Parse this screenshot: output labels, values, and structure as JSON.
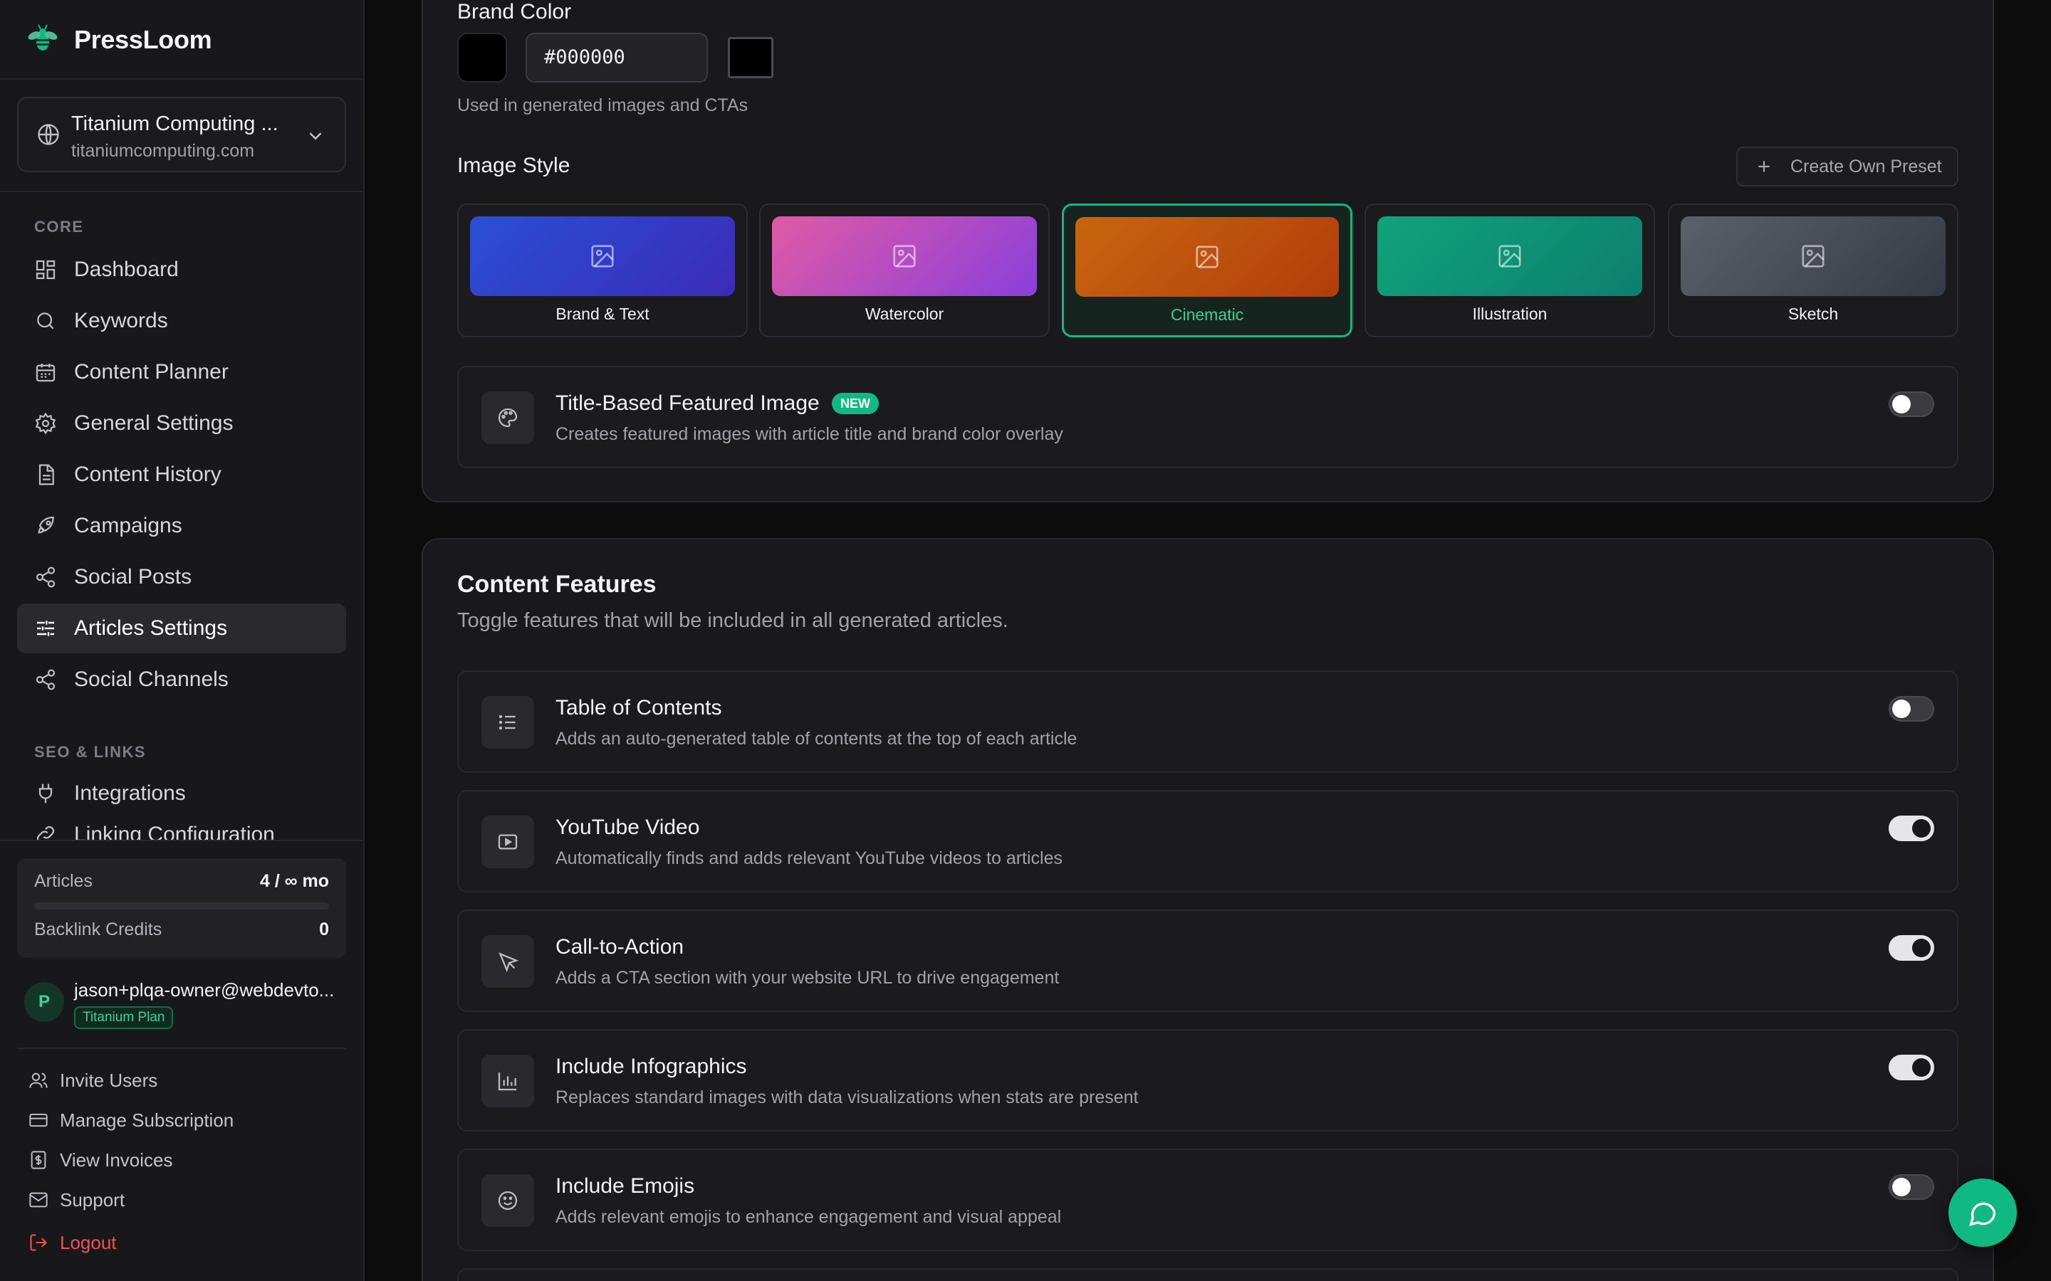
{
  "app": {
    "name": "PressLoom"
  },
  "site": {
    "name": "Titanium Computing ...",
    "domain": "titaniumcomputing.com"
  },
  "sidebar": {
    "core_label": "CORE",
    "seo_label": "SEO & LINKS",
    "items": [
      {
        "label": "Dashboard",
        "icon": "dashboard-icon"
      },
      {
        "label": "Keywords",
        "icon": "search-icon"
      },
      {
        "label": "Content Planner",
        "icon": "calendar-icon"
      },
      {
        "label": "General Settings",
        "icon": "gear-icon"
      },
      {
        "label": "Content History",
        "icon": "document-icon"
      },
      {
        "label": "Campaigns",
        "icon": "rocket-icon"
      },
      {
        "label": "Social Posts",
        "icon": "share-icon"
      },
      {
        "label": "Articles Settings",
        "icon": "sliders-icon",
        "active": true
      },
      {
        "label": "Social Channels",
        "icon": "share-icon"
      }
    ],
    "seo_items": [
      {
        "label": "Integrations",
        "icon": "plug-icon"
      },
      {
        "label": "Linking Configuration",
        "icon": "link-icon"
      }
    ]
  },
  "usage": {
    "articles_label": "Articles",
    "articles_value": "4 / ∞ mo",
    "backlink_label": "Backlink Credits",
    "backlink_value": "0"
  },
  "user": {
    "initial": "P",
    "email": "jason+plqa-owner@webdevto...",
    "plan": "Titanium Plan"
  },
  "footer_links": [
    {
      "label": "Invite Users",
      "icon": "users-icon"
    },
    {
      "label": "Manage Subscription",
      "icon": "credit-card-icon"
    },
    {
      "label": "View Invoices",
      "icon": "invoice-icon"
    },
    {
      "label": "Support",
      "icon": "mail-icon"
    },
    {
      "label": "Logout",
      "icon": "logout-icon"
    }
  ],
  "brand_color": {
    "label": "Brand Color",
    "value": "#000000",
    "hint": "Used in generated images and CTAs"
  },
  "image_style": {
    "label": "Image Style",
    "preset_button": "Create Own Preset",
    "options": [
      {
        "label": "Brand & Text",
        "from": "#2a4fd6",
        "to": "#3b2bb8"
      },
      {
        "label": "Watercolor",
        "from": "#e05aa6",
        "to": "#8a3fdc"
      },
      {
        "label": "Cinematic",
        "from": "#c8660e",
        "to": "#b23d0c",
        "selected": true
      },
      {
        "label": "Illustration",
        "from": "#10a37a",
        "to": "#0d7f6f"
      },
      {
        "label": "Sketch",
        "from": "#5b606b",
        "to": "#353a45"
      }
    ]
  },
  "title_featured": {
    "title": "Title-Based Featured Image",
    "badge": "NEW",
    "desc": "Creates featured images with article title and brand color overlay",
    "enabled": false
  },
  "content_features": {
    "title": "Content Features",
    "subtitle": "Toggle features that will be included in all generated articles.",
    "items": [
      {
        "title": "Table of Contents",
        "desc": "Adds an auto-generated table of contents at the top of each article",
        "icon": "list-icon",
        "enabled": false
      },
      {
        "title": "YouTube Video",
        "desc": "Automatically finds and adds relevant YouTube videos to articles",
        "icon": "video-icon",
        "enabled": true
      },
      {
        "title": "Call-to-Action",
        "desc": "Adds a CTA section with your website URL to drive engagement",
        "icon": "cursor-icon",
        "enabled": true
      },
      {
        "title": "Include Infographics",
        "desc": "Replaces standard images with data visualizations when stats are present",
        "icon": "bar-chart-icon",
        "enabled": true
      },
      {
        "title": "Include Emojis",
        "desc": "Adds relevant emojis to enhance engagement and visual appeal",
        "icon": "smile-icon",
        "enabled": false
      }
    ]
  },
  "colors": {
    "accent": "#10b981",
    "danger": "#f05252"
  }
}
